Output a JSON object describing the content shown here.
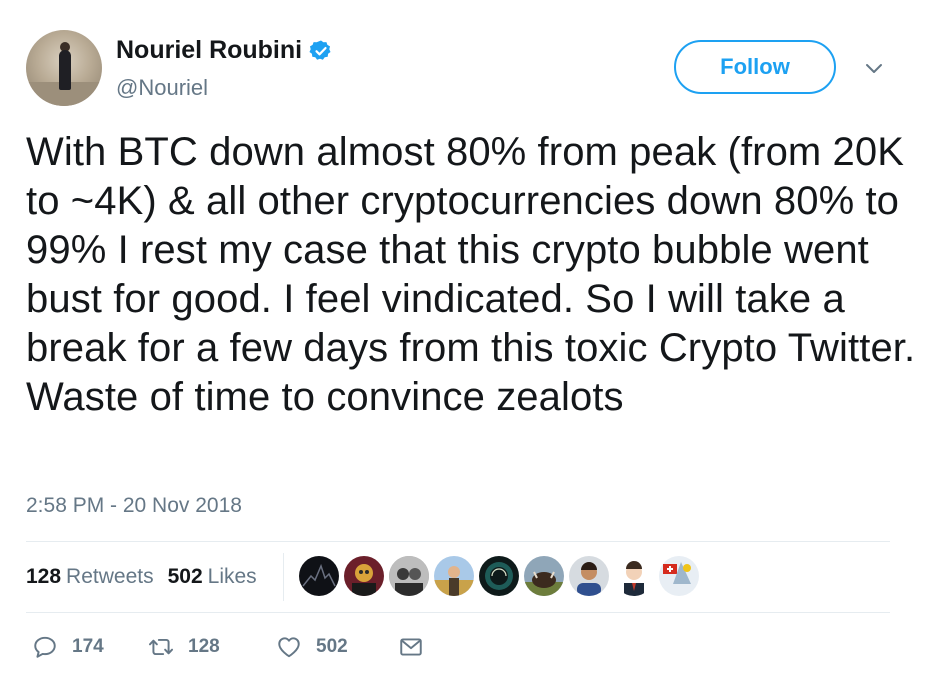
{
  "user": {
    "name": "Nouriel Roubini",
    "handle": "@Nouriel",
    "verified": true
  },
  "header": {
    "follow_label": "Follow"
  },
  "tweet": {
    "text": "With BTC down almost 80% from peak (from 20K to ~4K) & all other cryptocurrencies down 80% to 99% I rest my case that this crypto bubble went bust for good. I feel vindicated. So I will take a break for a few days from this toxic Crypto Twitter. Waste of time to convince zealots",
    "timestamp": "2:58 PM - 20 Nov 2018"
  },
  "stats": {
    "retweets_count": "128",
    "retweets_label": "Retweets",
    "likes_count": "502",
    "likes_label": "Likes"
  },
  "actions": {
    "reply_count": "174",
    "retweet_count": "128",
    "like_count": "502"
  },
  "colors": {
    "accent": "#1da1f2",
    "text": "#14171a",
    "muted": "#657786",
    "divider": "#e6ecf0"
  },
  "icons": {
    "verified": "verified-badge-icon",
    "chevron": "chevron-down-icon",
    "reply": "reply-icon",
    "retweet": "retweet-icon",
    "like": "heart-icon",
    "message": "envelope-icon"
  }
}
